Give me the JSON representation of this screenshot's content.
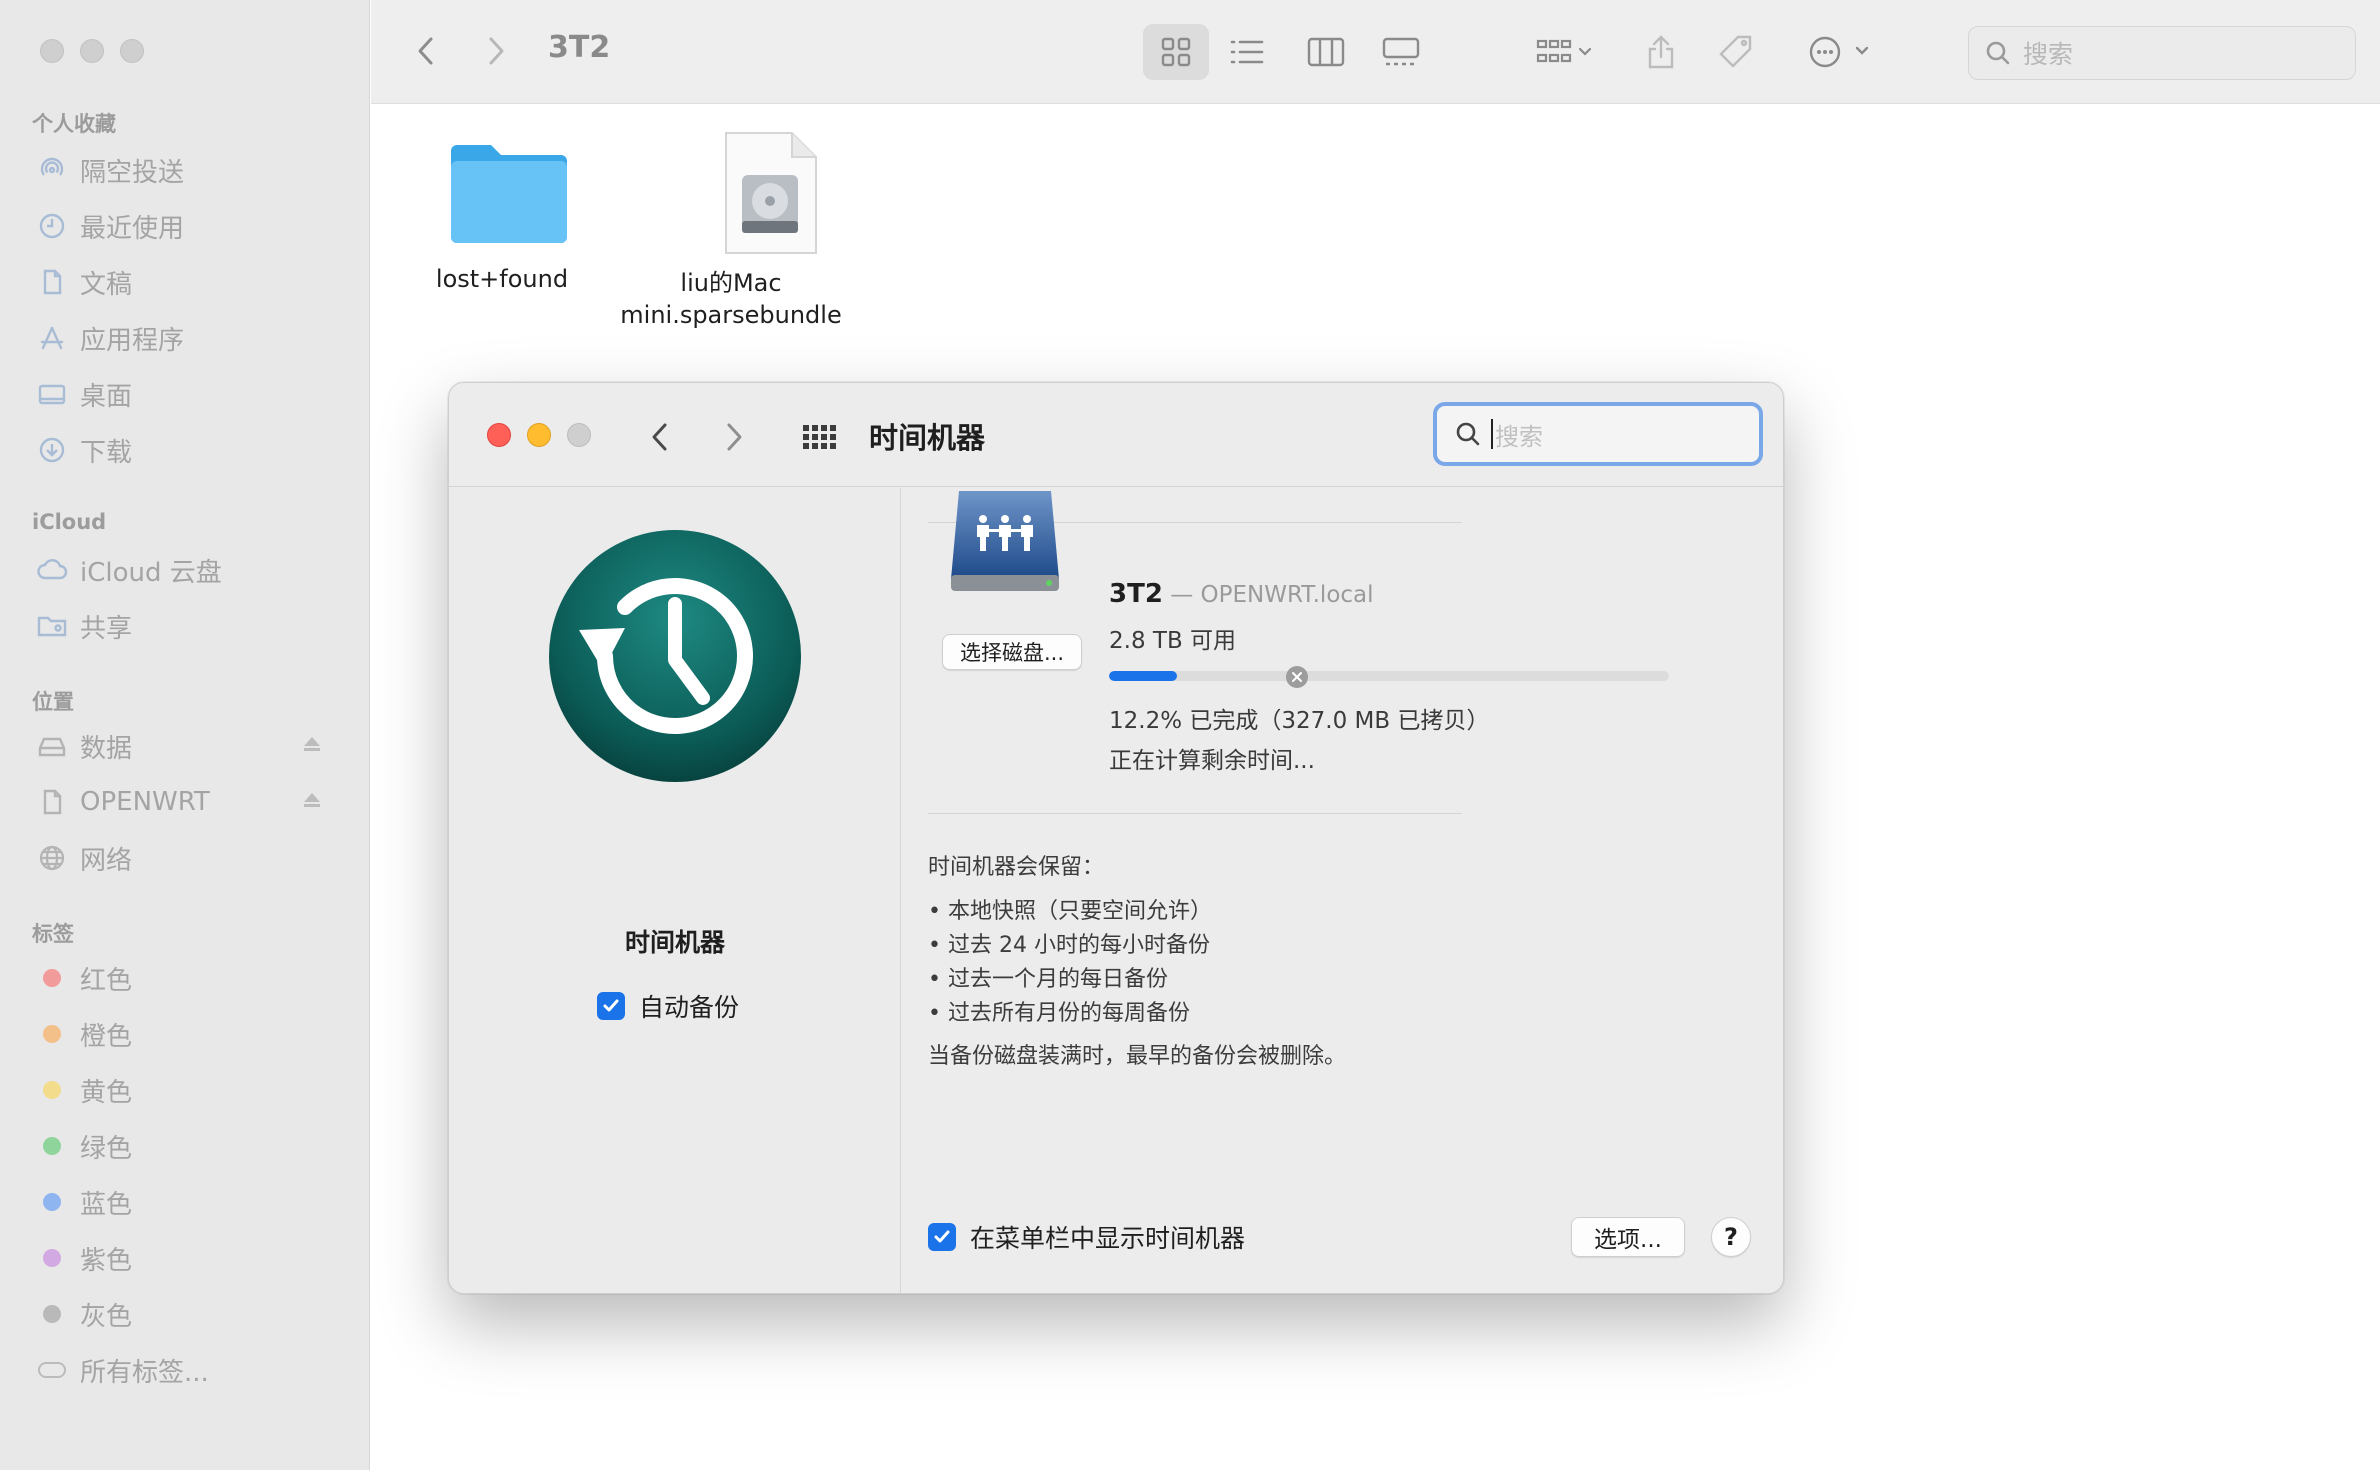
{
  "finder": {
    "sidebar": {
      "sections": {
        "favorites": "个人收藏",
        "icloud": "iCloud",
        "locations": "位置",
        "tags": "标签"
      },
      "favorites": [
        {
          "label": "隔空投送",
          "icon": "airdrop-icon"
        },
        {
          "label": "最近使用",
          "icon": "clock-icon"
        },
        {
          "label": "文稿",
          "icon": "document-icon"
        },
        {
          "label": "应用程序",
          "icon": "applications-icon"
        },
        {
          "label": "桌面",
          "icon": "desktop-icon"
        },
        {
          "label": "下载",
          "icon": "download-icon"
        }
      ],
      "icloud": [
        {
          "label": "iCloud 云盘",
          "icon": "cloud-icon"
        },
        {
          "label": "共享",
          "icon": "shared-folder-icon"
        }
      ],
      "locations": [
        {
          "label": "数据",
          "icon": "drive-icon"
        },
        {
          "label": "OPENWRT",
          "icon": "document-icon"
        },
        {
          "label": "网络",
          "icon": "network-icon"
        }
      ],
      "tags": [
        {
          "label": "红色",
          "color": "#f29b9b"
        },
        {
          "label": "橙色",
          "color": "#f4c08a"
        },
        {
          "label": "黄色",
          "color": "#f3dc8c"
        },
        {
          "label": "绿色",
          "color": "#8fd49a"
        },
        {
          "label": "蓝色",
          "color": "#8fb5f0"
        },
        {
          "label": "紫色",
          "color": "#d3a9e3"
        },
        {
          "label": "灰色",
          "color": "#b9b9b9"
        },
        {
          "label": "所有标签...",
          "color": ""
        }
      ]
    },
    "toolbar": {
      "title": "3T2",
      "search_placeholder": "搜索"
    },
    "files": [
      {
        "name_line1": "lost+found",
        "name_line2": "",
        "icon": "folder-icon"
      },
      {
        "name_line1": "liu的Mac",
        "name_line2": "mini.sparsebundle",
        "icon": "sparsebundle-icon"
      }
    ]
  },
  "prefs": {
    "title": "时间机器",
    "search_placeholder": "搜索",
    "app_name": "时间机器",
    "auto_backup_label": "自动备份",
    "auto_backup_checked": true,
    "disk": {
      "name": "3T2",
      "host": " — OPENWRT.local",
      "available": "2.8 TB 可用",
      "progress": 0.122,
      "status": "12.2% 已完成（327.0 MB 已拷贝）",
      "eta": "正在计算剩余时间...",
      "select_button": "选择磁盘..."
    },
    "keep_title": "时间机器会保留：",
    "keep_items": [
      "本地快照（只要空间允许）",
      "过去 24 小时的每小时备份",
      "过去一个月的每日备份",
      "过去所有月份的每周备份"
    ],
    "keep_note": "当备份磁盘装满时，最早的备份会被删除。",
    "menubar_label": "在菜单栏中显示时间机器",
    "menubar_checked": true,
    "options_button": "选项...",
    "help_button": "?"
  }
}
